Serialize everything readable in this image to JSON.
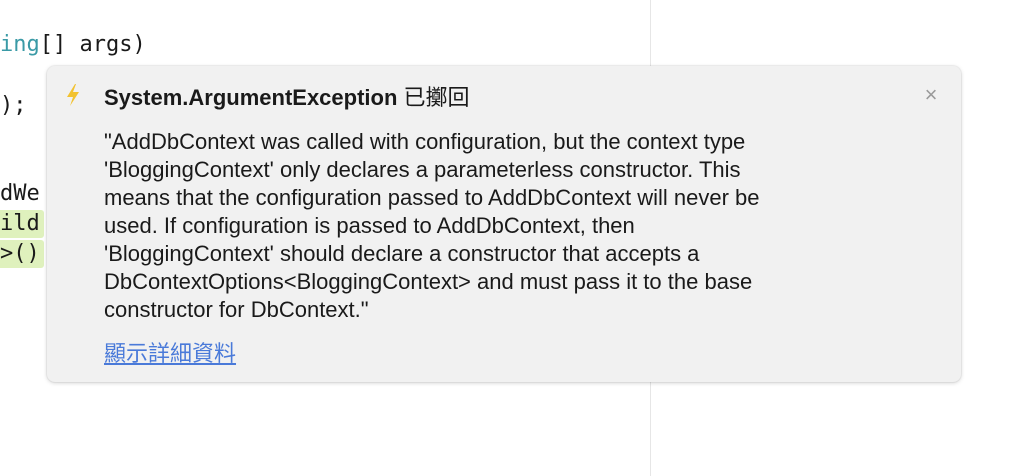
{
  "code": {
    "line1_type": "ing",
    "line1_rest": "[] args)",
    "line2": ");",
    "line3": "dWe",
    "line4": "ild",
    "line5": ">()"
  },
  "popup": {
    "icon": "lightning-bolt-icon",
    "exception_name": "System.ArgumentException",
    "status": "已擲回",
    "close_label": "×",
    "message_lines": [
      "\"AddDbContext was called with configuration, but the context type",
      "'BloggingContext' only declares a parameterless constructor. This",
      "means that the configuration passed to AddDbContext will never be",
      "used. If configuration is passed to AddDbContext, then",
      "'BloggingContext' should declare a constructor that accepts a",
      "DbContextOptions<BloggingContext> and must pass it to the base",
      "constructor for DbContext.\""
    ],
    "details_link": "顯示詳細資料"
  },
  "colors": {
    "bolt": "#f2c230",
    "link": "#4a7ad9",
    "highlight": "#dff1bd",
    "type_keyword": "#3a9aa6"
  }
}
